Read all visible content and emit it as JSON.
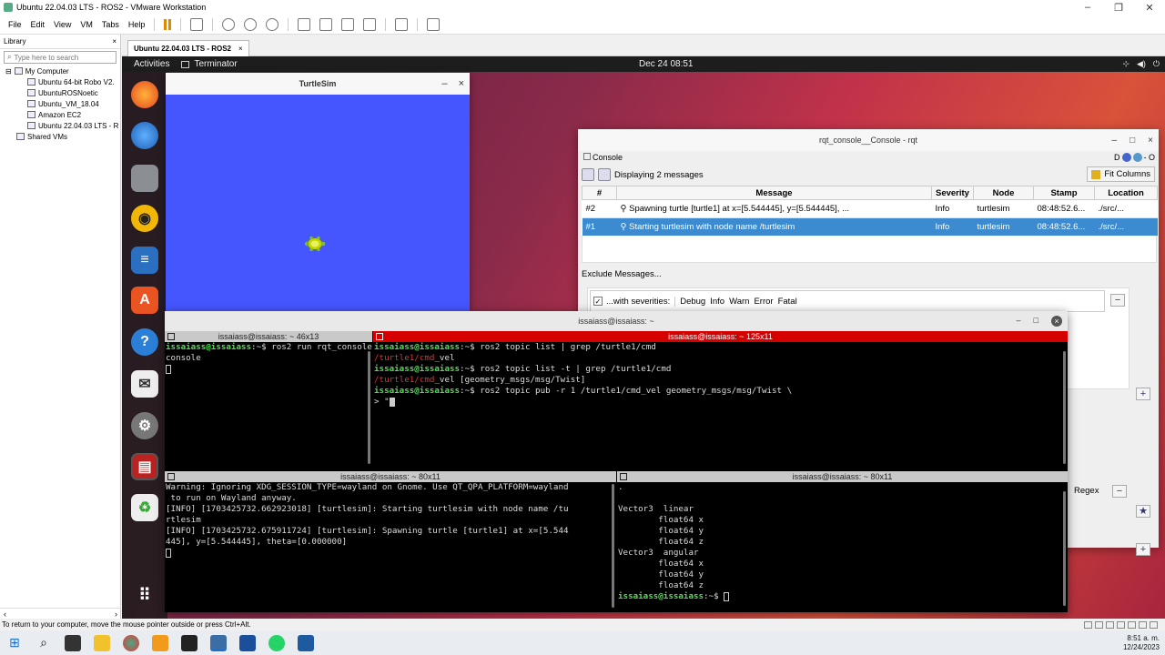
{
  "vmware": {
    "title": "Ubuntu 22.04.03 LTS - ROS2 - VMware Workstation",
    "menus": [
      "File",
      "Edit",
      "View",
      "VM",
      "Tabs",
      "Help"
    ],
    "tab_label": "Ubuntu 22.04.03 LTS - ROS2",
    "tab_close": "×",
    "status_hint": "To return to your computer, move the mouse pointer outside or press Ctrl+Alt."
  },
  "library": {
    "title": "Library",
    "close": "×",
    "search_placeholder": "Type here to search",
    "root": "My Computer",
    "vms": [
      "Ubuntu 64-bit Robo V2.",
      "UbuntuROSNoetic",
      "Ubuntu_VM_18.04",
      "Amazon EC2",
      "Ubuntu 22.04.03 LTS - R"
    ],
    "shared": "Shared VMs"
  },
  "ubuntu": {
    "activities": "Activities",
    "app_name": "Terminator",
    "clock": "Dec 24  08:51"
  },
  "turtlesim": {
    "title": "TurtleSim",
    "min": "–",
    "close": "×",
    "bg_color": "#4556ff"
  },
  "rqt": {
    "title": "rqt_console__Console - rqt",
    "console_label": "Console",
    "console_right": "D",
    "displaying": "Displaying 2 messages",
    "fit_columns": "Fit Columns",
    "columns": [
      "#",
      "Message",
      "Severity",
      "Node",
      "Stamp",
      "Location"
    ],
    "rows": [
      {
        "num": "#2",
        "message": "Spawning turtle [turtle1] at x=[5.544445], y=[5.544445], ...",
        "severity": "Info",
        "node": "turtlesim",
        "stamp": "08:48:52.6...",
        "location": "./src/..."
      },
      {
        "num": "#1",
        "message": "Starting turtlesim with node name /turtlesim",
        "severity": "Info",
        "node": "turtlesim",
        "stamp": "08:48:52.6...",
        "location": "./src/..."
      }
    ],
    "exclude_label": "Exclude Messages...",
    "with_severities": "...with severities:",
    "severities": [
      "Debug",
      "Info",
      "Warn",
      "Error",
      "Fatal"
    ],
    "regex": "Regex",
    "minus": "−",
    "plus": "+"
  },
  "terminator": {
    "title": "issaiass@issaiass: ~",
    "pane_tl": {
      "title": "issaiass@issaiass: ~ 46x13",
      "prompt": "issaiass@issaiass",
      "path": ":~$ ",
      "cmd": "ros2 run rqt_console rqt_",
      "cont": "console"
    },
    "pane_tr": {
      "title": "issaiass@issaiass: ~ 125x11",
      "prompt": "issaiass@issaiass",
      "path": ":~$ ",
      "cmd1": "ros2 topic list | grep /turtle1/cmd",
      "out1_match": "/turtle1/cmd",
      "out1_rest": "_vel",
      "cmd2": "ros2 topic list -t | grep /turtle1/cmd",
      "out2_match": "/turtle1/cmd",
      "out2_rest": "_vel [geometry_msgs/msg/Twist]",
      "cmd3": "ros2 topic pub -r 1 /turtle1/cmd_vel geometry_msgs/msg/Twist \\",
      "cont": "> \""
    },
    "pane_bl": {
      "title": "issaiass@issaiass: ~ 80x11",
      "lines": [
        "Warning: Ignoring XDG_SESSION_TYPE=wayland on Gnome. Use QT_QPA_PLATFORM=wayland",
        " to run on Wayland anyway.",
        "[INFO] [1703425732.662923018] [turtlesim]: Starting turtlesim with node name /tu",
        "rtlesim",
        "[INFO] [1703425732.675911724] [turtlesim]: Spawning turtle [turtle1] at x=[5.544",
        "445], y=[5.544445], theta=[0.000000]"
      ]
    },
    "pane_br": {
      "title": "issaiass@issaiass: ~ 80x11",
      "lines": [
        ".",
        "",
        "Vector3  linear",
        "        float64 x",
        "        float64 y",
        "        float64 z",
        "Vector3  angular",
        "        float64 x",
        "        float64 y",
        "        float64 z"
      ],
      "prompt": "issaiass@issaiass",
      "path": ":~$ "
    }
  },
  "taskbar": {
    "time": "8:51 a. m.",
    "date": "12/24/2023"
  }
}
